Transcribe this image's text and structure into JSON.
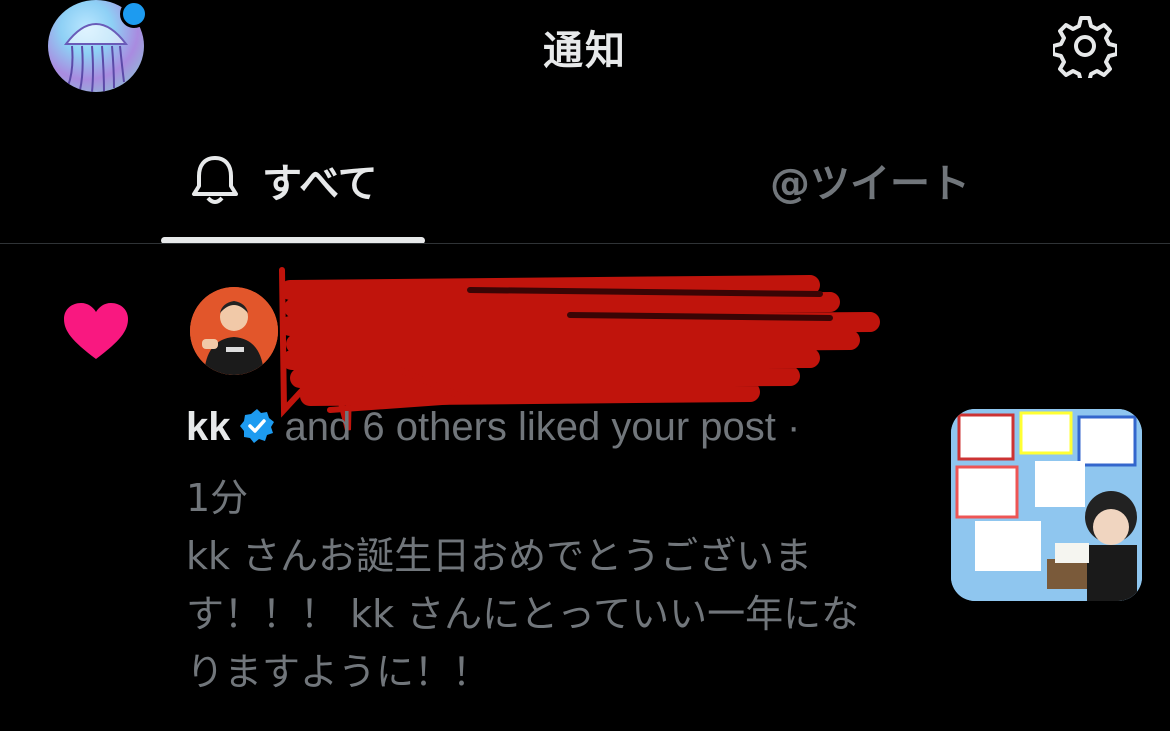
{
  "header": {
    "title": "通知",
    "avatar_icon": "jellyfish-avatar-icon",
    "settings_icon": "gear-icon"
  },
  "tabs": [
    {
      "label": "すべて",
      "icon": "bell-icon",
      "active": true
    },
    {
      "label": "@ツイート",
      "active": false
    }
  ],
  "notification": {
    "type_icon": "heart-icon",
    "name": "kk",
    "verified": true,
    "action_text": "and 6 others liked your post ·",
    "time": "1分",
    "post_text": "kk さんお誕生日おめでとうございます！！！ kk さんにとっていい一年になりますように！！",
    "colors": {
      "heart": "#f91880",
      "verified": "#1d9bf0",
      "redaction": "#c0140c"
    }
  }
}
